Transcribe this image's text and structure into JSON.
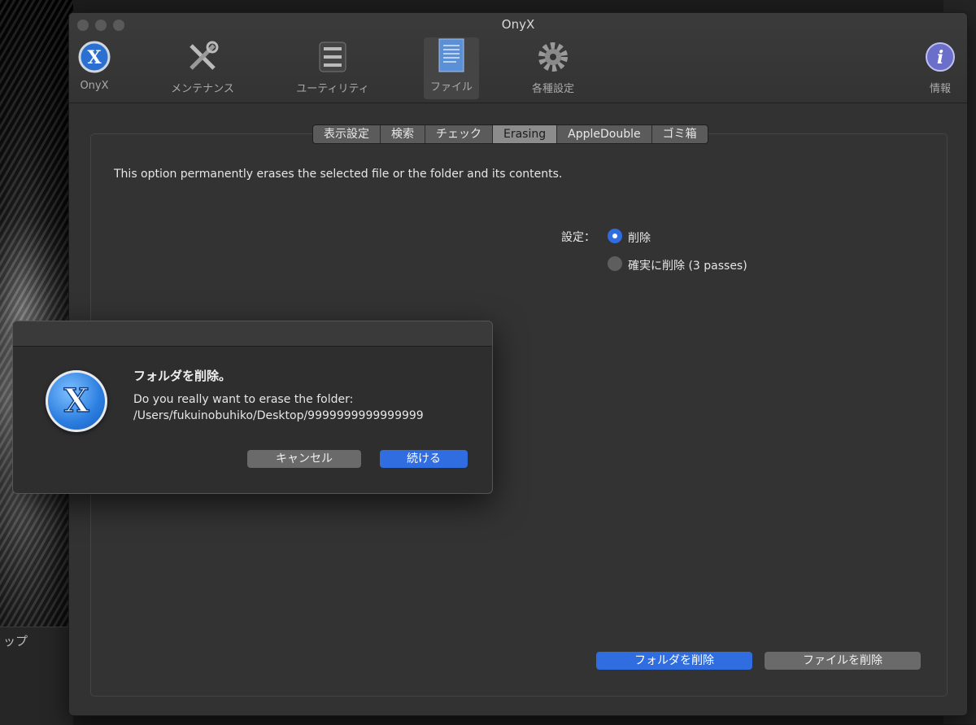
{
  "window": {
    "title": "OnyX"
  },
  "toolbar": {
    "items": [
      {
        "label": "OnyX",
        "icon": "onyx-logo-icon"
      },
      {
        "label": "メンテナンス",
        "icon": "tools-icon"
      },
      {
        "label": "ユーティリティ",
        "icon": "utility-icon"
      },
      {
        "label": "ファイル",
        "icon": "file-icon",
        "active": true
      },
      {
        "label": "各種設定",
        "icon": "gear-icon"
      },
      {
        "label": "情報",
        "icon": "info-icon"
      }
    ]
  },
  "tabs": [
    "表示設定",
    "検索",
    "チェック",
    "Erasing",
    "AppleDouble",
    "ゴミ箱"
  ],
  "selected_tab": "Erasing",
  "main": {
    "description": "This option permanently erases the selected file or the folder and its contents.",
    "setting_label": "設定：",
    "options": [
      {
        "label": "削除",
        "selected": true
      },
      {
        "label": "確実に削除 (3 passes)",
        "selected": false
      }
    ],
    "delete_folder_button": "フォルダを削除",
    "delete_file_button": "ファイルを削除"
  },
  "dialog": {
    "title": "フォルダを削除。",
    "message_line1": "Do you really want to erase the folder:",
    "message_line2": "/Users/fukuinobuhiko/Desktop/9999999999999999",
    "cancel_label": "キャンセル",
    "continue_label": "続ける"
  },
  "desktop": {
    "partial_label": "ップ"
  },
  "colors": {
    "accent": "#2f6de1",
    "window_bg": "#323232"
  }
}
